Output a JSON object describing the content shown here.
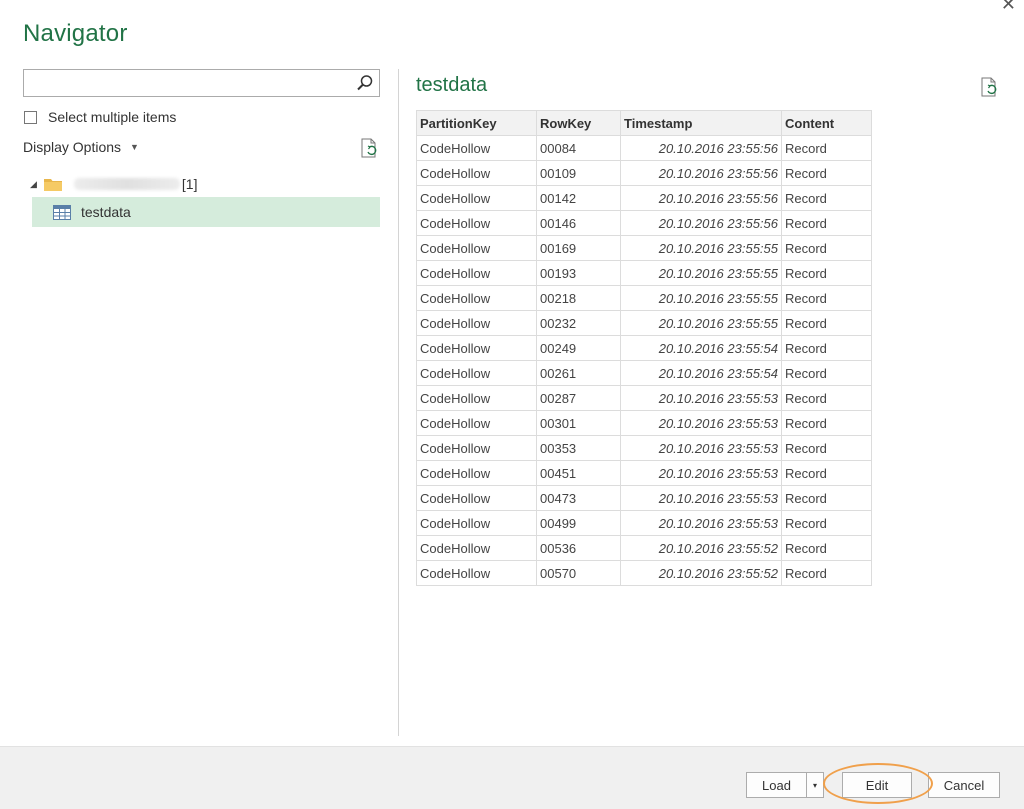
{
  "window": {
    "title": "Navigator",
    "close_glyph": "✕"
  },
  "left_pane": {
    "search": {
      "value": "",
      "placeholder": "",
      "icon": "search-icon"
    },
    "select_multiple_label": "Select multiple items",
    "select_multiple_checked": false,
    "display_options_label": "Display Options",
    "tree": {
      "root": {
        "name_blurred": true,
        "count_label": "[1]",
        "expanded": true
      },
      "children": [
        {
          "label": "testdata",
          "selected": true,
          "icon": "table-icon"
        }
      ]
    }
  },
  "preview": {
    "title": "testdata",
    "columns": [
      "PartitionKey",
      "RowKey",
      "Timestamp",
      "Content"
    ],
    "rows": [
      [
        "CodeHollow",
        "00084",
        "20.10.2016 23:55:56",
        "Record"
      ],
      [
        "CodeHollow",
        "00109",
        "20.10.2016 23:55:56",
        "Record"
      ],
      [
        "CodeHollow",
        "00142",
        "20.10.2016 23:55:56",
        "Record"
      ],
      [
        "CodeHollow",
        "00146",
        "20.10.2016 23:55:56",
        "Record"
      ],
      [
        "CodeHollow",
        "00169",
        "20.10.2016 23:55:55",
        "Record"
      ],
      [
        "CodeHollow",
        "00193",
        "20.10.2016 23:55:55",
        "Record"
      ],
      [
        "CodeHollow",
        "00218",
        "20.10.2016 23:55:55",
        "Record"
      ],
      [
        "CodeHollow",
        "00232",
        "20.10.2016 23:55:55",
        "Record"
      ],
      [
        "CodeHollow",
        "00249",
        "20.10.2016 23:55:54",
        "Record"
      ],
      [
        "CodeHollow",
        "00261",
        "20.10.2016 23:55:54",
        "Record"
      ],
      [
        "CodeHollow",
        "00287",
        "20.10.2016 23:55:53",
        "Record"
      ],
      [
        "CodeHollow",
        "00301",
        "20.10.2016 23:55:53",
        "Record"
      ],
      [
        "CodeHollow",
        "00353",
        "20.10.2016 23:55:53",
        "Record"
      ],
      [
        "CodeHollow",
        "00451",
        "20.10.2016 23:55:53",
        "Record"
      ],
      [
        "CodeHollow",
        "00473",
        "20.10.2016 23:55:53",
        "Record"
      ],
      [
        "CodeHollow",
        "00499",
        "20.10.2016 23:55:53",
        "Record"
      ],
      [
        "CodeHollow",
        "00536",
        "20.10.2016 23:55:52",
        "Record"
      ],
      [
        "CodeHollow",
        "00570",
        "20.10.2016 23:55:52",
        "Record"
      ]
    ]
  },
  "footer": {
    "load_label": "Load",
    "load_arrow_glyph": "▾",
    "edit_label": "Edit",
    "cancel_label": "Cancel",
    "highlighted_button": "Edit"
  },
  "colors": {
    "accent": "#217346",
    "selection": "#d5ecdc",
    "highlight_oval": "#f0a04b"
  }
}
